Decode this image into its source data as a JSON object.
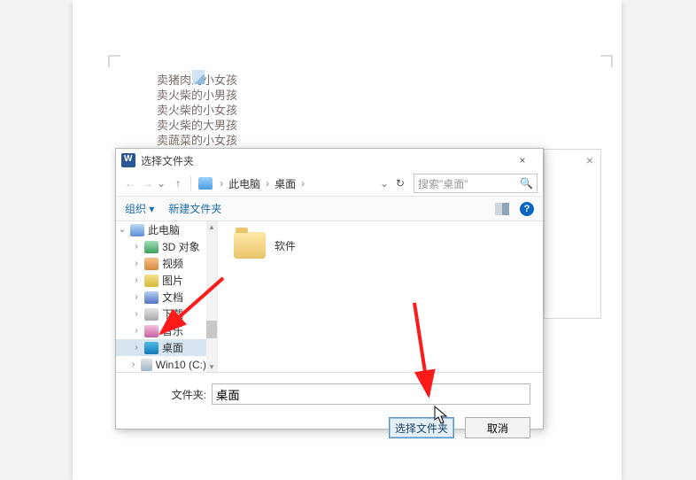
{
  "document": {
    "lines": [
      "卖猪肉的小女孩",
      "卖火柴的小男孩",
      "卖火柴的小女孩",
      "卖火柴的大男孩",
      "卖蔬菜的小女孩"
    ]
  },
  "side_panel": {
    "close": "×"
  },
  "dialog": {
    "title": "选择文件夹",
    "close": "×",
    "nav": {
      "back": "←",
      "forward": "→",
      "up": "↑",
      "refresh": "↻",
      "dropdown": "⌄",
      "breadcrumb": [
        "此电脑",
        "桌面"
      ],
      "search_placeholder": "搜索\"桌面\"",
      "search_icon": "🔍"
    },
    "toolbar": {
      "organize": "组织 ▾",
      "new_folder": "新建文件夹",
      "help": "?"
    },
    "tree": [
      {
        "label": "此电脑",
        "expander": "⌄",
        "icon": "pc",
        "level": 0,
        "selected": false
      },
      {
        "label": "3D 对象",
        "expander": "›",
        "icon": "obj3d",
        "level": 1,
        "selected": false
      },
      {
        "label": "视频",
        "expander": "›",
        "icon": "video",
        "level": 1,
        "selected": false
      },
      {
        "label": "图片",
        "expander": "›",
        "icon": "pic",
        "level": 1,
        "selected": false
      },
      {
        "label": "文档",
        "expander": "›",
        "icon": "doc",
        "level": 1,
        "selected": false
      },
      {
        "label": "下载",
        "expander": "›",
        "icon": "dl",
        "level": 1,
        "selected": false
      },
      {
        "label": "音乐",
        "expander": "›",
        "icon": "music",
        "level": 1,
        "selected": false
      },
      {
        "label": "桌面",
        "expander": "›",
        "icon": "desk",
        "level": 1,
        "selected": true
      },
      {
        "label": "Win10 (C:)",
        "expander": "›",
        "icon": "drive",
        "level": 1,
        "selected": false
      }
    ],
    "contents": [
      {
        "label": "软件",
        "icon": "folder"
      }
    ],
    "footer": {
      "field_label": "文件夹:",
      "field_value": "桌面",
      "select_btn": "选择文件夹",
      "cancel_btn": "取消"
    }
  }
}
